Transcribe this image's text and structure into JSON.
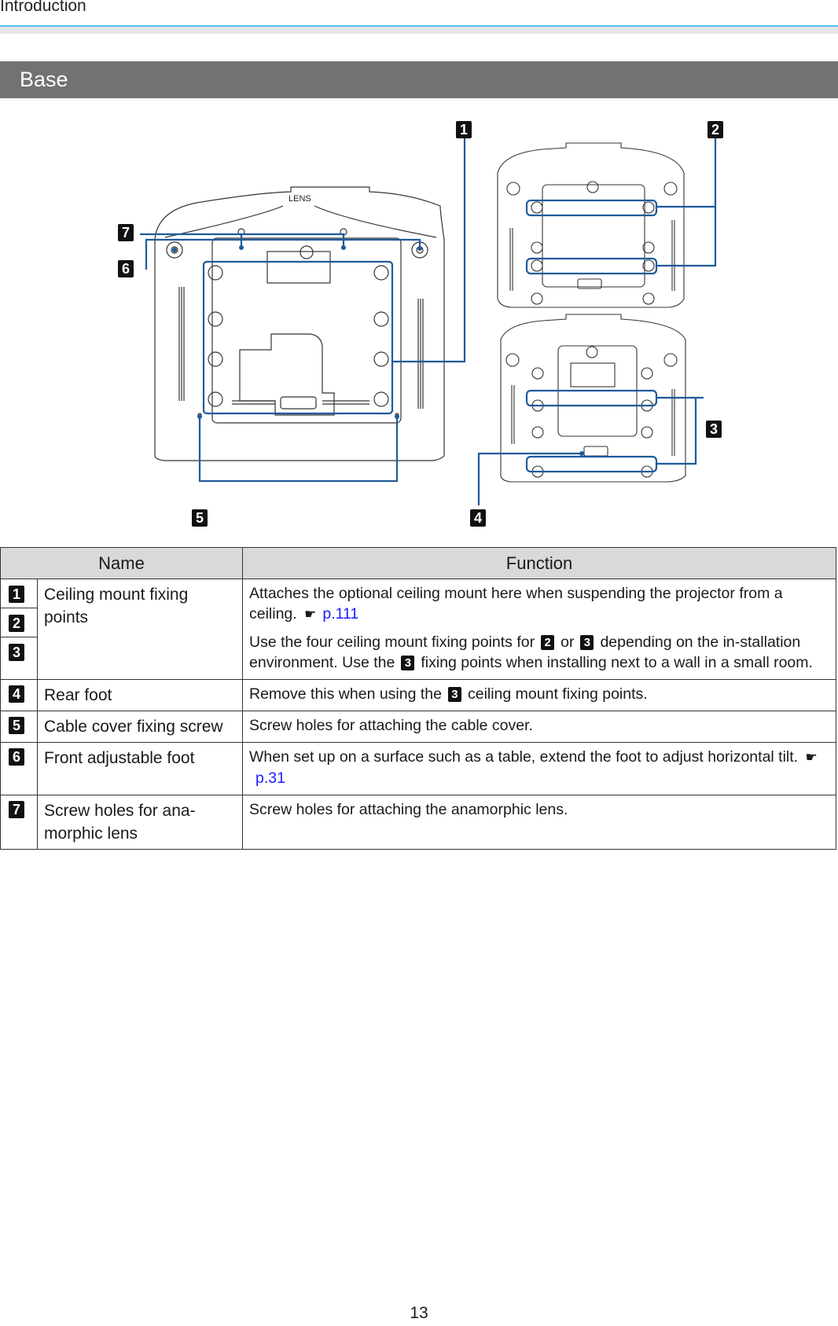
{
  "header": {
    "running_title": "Introduction"
  },
  "section": {
    "title": "Base"
  },
  "figure": {
    "lens_label": "LENS",
    "callouts": [
      "1",
      "2",
      "3",
      "4",
      "5",
      "6",
      "7"
    ],
    "line_color": "#1f5b9a"
  },
  "table": {
    "headers": {
      "name": "Name",
      "function": "Function"
    },
    "rows": [
      {
        "numbers": [
          "1",
          "2",
          "3"
        ],
        "name": "Ceiling mount fixing points",
        "function": [
          {
            "text": "Attaches the optional ceiling mount here when suspending the projector from a ceiling.",
            "ref_icon": "pointing-hand-icon",
            "ref": "p.111"
          },
          {
            "parts": [
              "Use the four ceiling mount fixing points for",
              "2",
              "or",
              "3",
              "depending on the in-stallation environment. Use the",
              "3",
              "fixing points when installing next to a wall in a small room."
            ]
          }
        ]
      },
      {
        "numbers": [
          "4"
        ],
        "name": "Rear foot",
        "function": [
          {
            "parts": [
              "Remove this when using the",
              "3",
              "ceiling mount fixing points."
            ]
          }
        ]
      },
      {
        "numbers": [
          "5"
        ],
        "name": "Cable cover fixing screw",
        "function": [
          {
            "text": "Screw holes for attaching the cable cover."
          }
        ]
      },
      {
        "numbers": [
          "6"
        ],
        "name": "Front adjustable foot",
        "function": [
          {
            "text": "When set up on a surface such as a table, extend the foot to adjust horizontal tilt.",
            "ref_icon": "pointing-hand-icon",
            "ref": "p.31"
          }
        ]
      },
      {
        "numbers": [
          "7"
        ],
        "name": "Screw holes for ana-morphic lens",
        "function": [
          {
            "text": "Screw holes for attaching the anamorphic lens."
          }
        ]
      }
    ]
  },
  "footer": {
    "page_number": "13"
  },
  "colors": {
    "accent_rule": "#4cc3ee",
    "section_bar": "#727272",
    "table_header": "#d9d9d9",
    "link": "#1a1aff"
  }
}
